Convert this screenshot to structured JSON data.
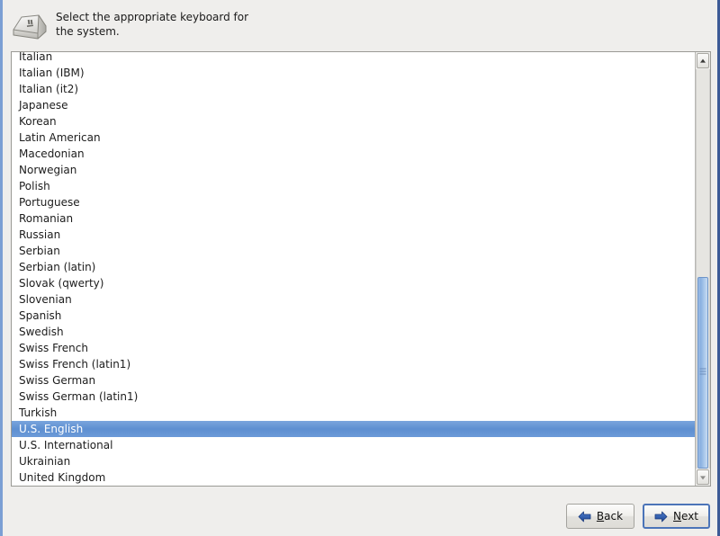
{
  "header": {
    "icon": "keyboard-key-icon",
    "instruction_line1": "Select the appropriate keyboard for",
    "instruction_line2": "the system."
  },
  "keyboard_list": {
    "name": "keyboard-layout-list",
    "selected_value": "U.S. English",
    "items": [
      {
        "label": "Italian",
        "selected": false
      },
      {
        "label": "Italian (IBM)",
        "selected": false
      },
      {
        "label": "Italian (it2)",
        "selected": false
      },
      {
        "label": "Japanese",
        "selected": false
      },
      {
        "label": "Korean",
        "selected": false
      },
      {
        "label": "Latin American",
        "selected": false
      },
      {
        "label": "Macedonian",
        "selected": false
      },
      {
        "label": "Norwegian",
        "selected": false
      },
      {
        "label": "Polish",
        "selected": false
      },
      {
        "label": "Portuguese",
        "selected": false
      },
      {
        "label": "Romanian",
        "selected": false
      },
      {
        "label": "Russian",
        "selected": false
      },
      {
        "label": "Serbian",
        "selected": false
      },
      {
        "label": "Serbian (latin)",
        "selected": false
      },
      {
        "label": "Slovak (qwerty)",
        "selected": false
      },
      {
        "label": "Slovenian",
        "selected": false
      },
      {
        "label": "Spanish",
        "selected": false
      },
      {
        "label": "Swedish",
        "selected": false
      },
      {
        "label": "Swiss French",
        "selected": false
      },
      {
        "label": "Swiss French (latin1)",
        "selected": false
      },
      {
        "label": "Swiss German",
        "selected": false
      },
      {
        "label": "Swiss German (latin1)",
        "selected": false
      },
      {
        "label": "Turkish",
        "selected": false
      },
      {
        "label": "U.S. English",
        "selected": true
      },
      {
        "label": "U.S. International",
        "selected": false
      },
      {
        "label": "Ukrainian",
        "selected": false
      },
      {
        "label": "United Kingdom",
        "selected": false
      }
    ]
  },
  "scrollbar": {
    "up_arrow": "scroll-up-arrow-icon",
    "down_arrow": "scroll-down-arrow-icon"
  },
  "buttons": {
    "back": {
      "text_before": "",
      "mnemonic": "B",
      "text_after": "ack",
      "icon": "arrow-left-icon",
      "focused": false
    },
    "next": {
      "text_before": "",
      "mnemonic": "N",
      "text_after": "ext",
      "icon": "arrow-right-icon",
      "focused": true
    }
  },
  "colors": {
    "selection_blue": "#5d8fd1",
    "window_bg": "#efeeec",
    "list_bg": "#ffffff",
    "arrow_blue": "#2a55a8",
    "focus_border": "#4b74b8"
  }
}
